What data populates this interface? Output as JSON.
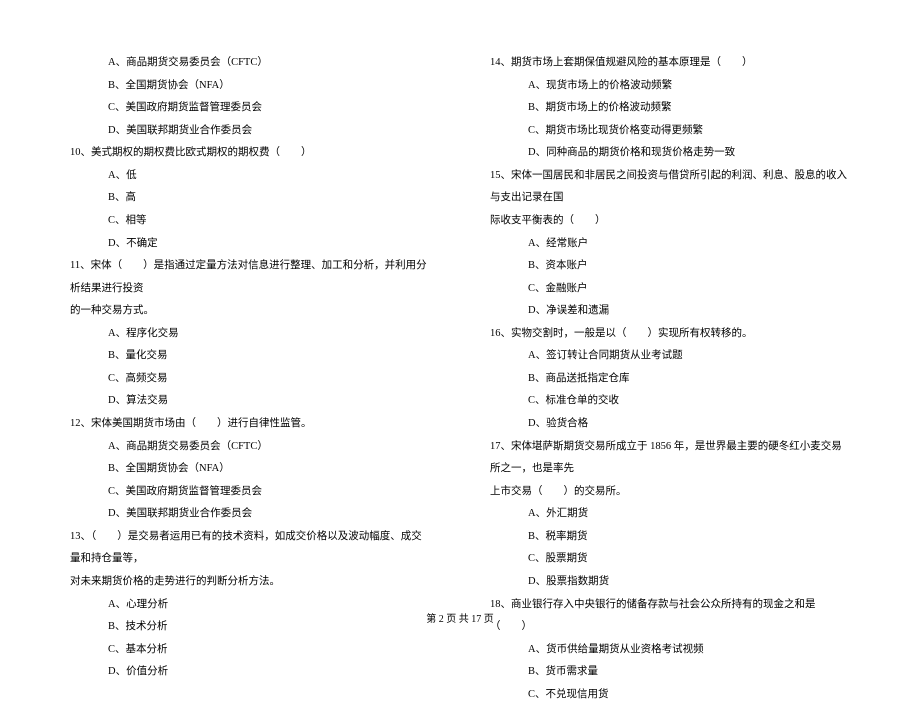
{
  "left": {
    "l1": "A、商品期货交易委员会（CFTC）",
    "l2": "B、全国期货协会（NFA）",
    "l3": "C、美国政府期货监督管理委员会",
    "l4": "D、美国联邦期货业合作委员会",
    "q10": "10、美式期权的期权费比欧式期权的期权费（　　）",
    "q10a": "A、低",
    "q10b": "B、高",
    "q10c": "C、相等",
    "q10d": "D、不确定",
    "q11": "11、宋体（　　）是指通过定量方法对信息进行整理、加工和分析，并利用分析结果进行投资",
    "q11cont": "的一种交易方式。",
    "q11a": "A、程序化交易",
    "q11b": "B、量化交易",
    "q11c": "C、高频交易",
    "q11d": "D、算法交易",
    "q12": "12、宋体美国期货市场由（　　）进行自律性监管。",
    "q12a": "A、商品期货交易委员会（CFTC）",
    "q12b": "B、全国期货协会（NFA）",
    "q12c": "C、美国政府期货监督管理委员会",
    "q12d": "D、美国联邦期货业合作委员会",
    "q13": "13、（　　）是交易者运用已有的技术资料，如成交价格以及波动幅度、成交量和持仓量等，",
    "q13cont": "对未来期货价格的走势进行的判断分析方法。",
    "q13a": "A、心理分析",
    "q13b": "B、技术分析",
    "q13c": "C、基本分析",
    "q13d": "D、价值分析"
  },
  "right": {
    "q14": "14、期货市场上套期保值规避风险的基本原理是（　　）",
    "q14a": "A、现货市场上的价格波动频繁",
    "q14b": "B、期货市场上的价格波动频繁",
    "q14c": "C、期货市场比现货价格变动得更频繁",
    "q14d": "D、同种商品的期货价格和现货价格走势一致",
    "q15": "15、宋体一国居民和非居民之间投资与借贷所引起的利润、利息、股息的收入与支出记录在国",
    "q15cont": "际收支平衡表的（　　）",
    "q15a": "A、经常账户",
    "q15b": "B、资本账户",
    "q15c": "C、金融账户",
    "q15d": "D、净误差和遗漏",
    "q16": "16、实物交割时，一般是以（　　）实现所有权转移的。",
    "q16a": "A、签订转让合同期货从业考试题",
    "q16b": "B、商品送抵指定仓库",
    "q16c": "C、标准仓单的交收",
    "q16d": "D、验货合格",
    "q17": "17、宋体堪萨斯期货交易所成立于 1856 年，是世界最主要的硬冬红小麦交易所之一，也是率先",
    "q17cont": "上市交易（　　）的交易所。",
    "q17a": "A、外汇期货",
    "q17b": "B、税率期货",
    "q17c": "C、股票期货",
    "q17d": "D、股票指数期货",
    "q18": "18、商业银行存入中央银行的储备存款与社会公众所持有的现金之和是（　　）",
    "q18a": "A、货币供给量期货从业资格考试视频",
    "q18b": "B、货币需求量",
    "q18c": "C、不兑现信用货"
  },
  "footer": "第 2 页 共 17 页"
}
